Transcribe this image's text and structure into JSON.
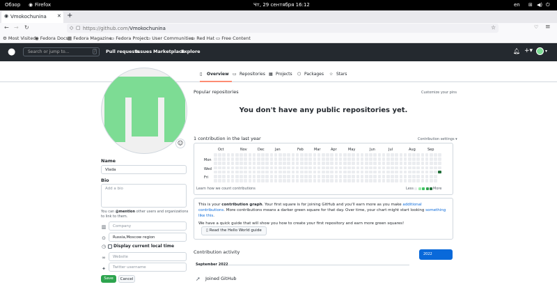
{
  "os_bar": {
    "activities": "Обзор",
    "app": "Firefox",
    "clock": "Чт, 29 сентября 16:12",
    "lang": "en"
  },
  "browser": {
    "tab_title": "Vmokochunina",
    "url_prefix": "https://github.com/",
    "url_path": "Vmokochunina",
    "bookmarks": [
      "Most Visited",
      "Fedora Docs",
      "Fedora Magazine",
      "Fedora Project",
      "User Communities",
      "Red Hat",
      "Free Content"
    ]
  },
  "gh_header": {
    "search_placeholder": "Search or jump to…",
    "nav": [
      "Pull requests",
      "Issues",
      "Marketplace",
      "Explore"
    ]
  },
  "profile_tabs": [
    "Overview",
    "Repositories",
    "Projects",
    "Packages",
    "Stars"
  ],
  "profile": {
    "name_label": "Name",
    "name_value": "Vlada",
    "bio_label": "Bio",
    "bio_placeholder": "Add a bio",
    "mention_prefix": "You can ",
    "mention_bold": "@mention",
    "mention_suffix": " other users and organizations to link to them.",
    "company_placeholder": "Company",
    "location_value": "Russia,Moscow region",
    "local_time_label": "Display current local time",
    "website_placeholder": "Website",
    "twitter_placeholder": "Twitter username",
    "save": "Save",
    "cancel": "Cancel",
    "avatar_color": "#7ddc94"
  },
  "popular": {
    "title": "Popular repositories",
    "customize": "Customize your pins",
    "empty": "You don't have any public repositories yet."
  },
  "contrib": {
    "title": "1 contribution in the last year",
    "settings": "Contribution settings",
    "months": [
      "Oct",
      "Nov",
      "Dec",
      "Jan",
      "Feb",
      "Mar",
      "Apr",
      "May",
      "Jun",
      "Jul",
      "Aug",
      "Sep"
    ],
    "days": [
      "Mon",
      "Wed",
      "Fri"
    ],
    "learn": "Learn how we count contributions",
    "less": "Less",
    "more": "More",
    "level_colors": [
      "#ebedf0",
      "#9be9a8",
      "#40c463",
      "#30a14e",
      "#216e39"
    ]
  },
  "info": {
    "p1_a": "This is your ",
    "p1_b": "contribution graph",
    "p1_c": ". Your first square is for joining GitHub and you'll earn more as you make ",
    "p1_link1": "additional contributions",
    "p1_d": ". More contributions means a darker green square for that day. Over time, your chart might start looking ",
    "p1_link2": "something like this",
    "p1_e": ".",
    "p2": "We have a quick guide that will show you how to create your first repository and earn more green squares!",
    "button": "Read the Hello World guide"
  },
  "activity": {
    "title": "Contribution activity",
    "month": "September 2022",
    "event": "Joined GitHub",
    "year": "2022"
  }
}
